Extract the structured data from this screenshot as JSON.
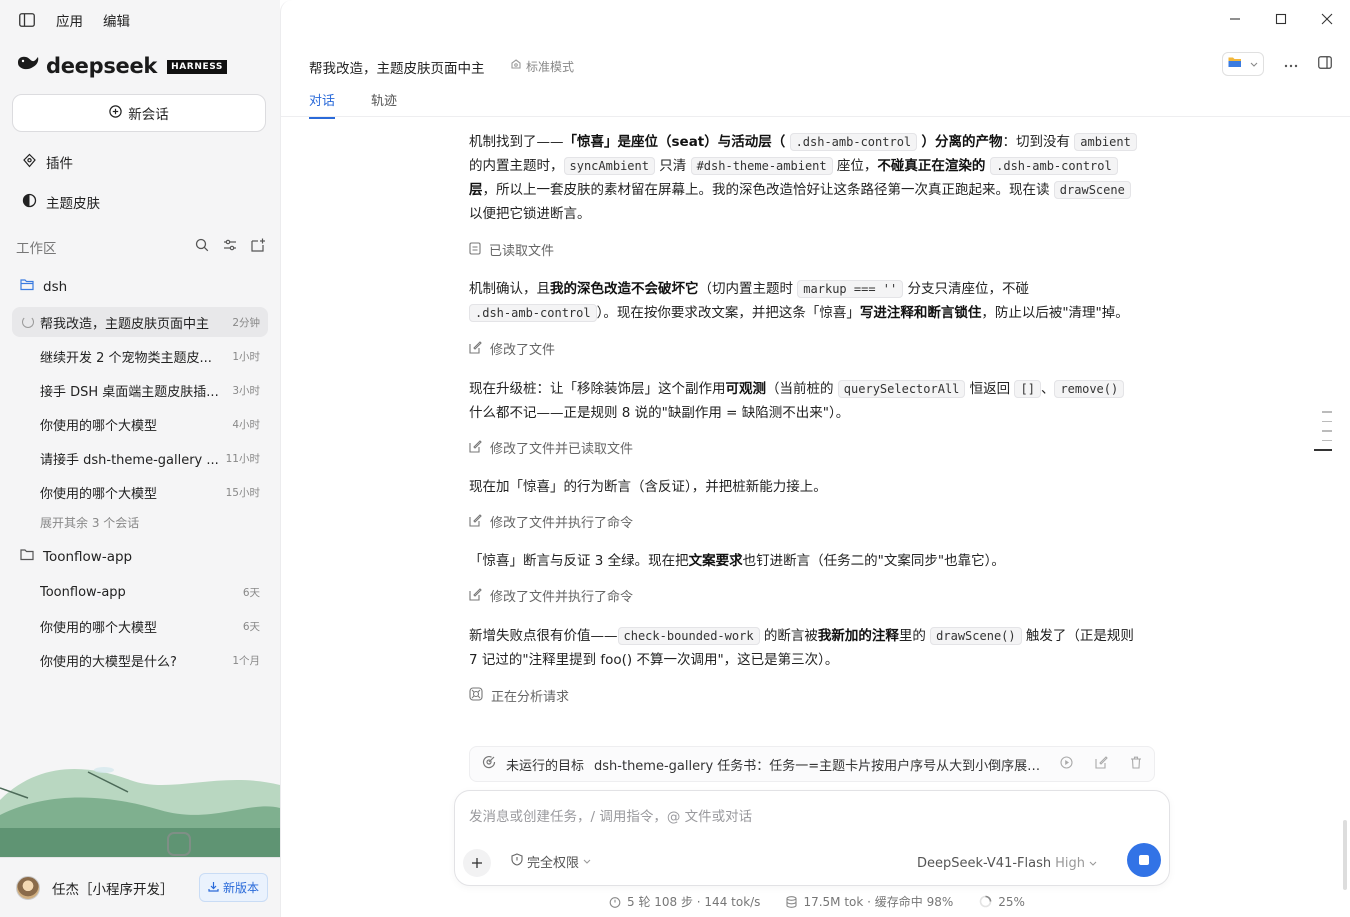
{
  "app": {
    "menu": [
      "应用",
      "编辑"
    ],
    "brand": "deepseek",
    "brand_tag": "HARNESS",
    "accent": "#2a6ad9"
  },
  "sidebar": {
    "new_chat": "新会话",
    "nav": [
      {
        "label": "插件",
        "icon": "plugin-icon"
      },
      {
        "label": "主题皮肤",
        "icon": "theme-icon"
      }
    ],
    "workspace_label": "工作区",
    "projects": [
      {
        "name": "dsh",
        "conversations": [
          {
            "title": "帮我改造，主题皮肤页面中主",
            "time": "2分钟",
            "active": true
          },
          {
            "title": "继续开发 2 个宠物类主题皮...",
            "time": "1小时"
          },
          {
            "title": "接手 DSH 桌面端主题皮肤插...",
            "time": "3小时"
          },
          {
            "title": "你使用的哪个大模型",
            "time": "4小时"
          },
          {
            "title": "请接手 dsh-theme-gallery ...",
            "time": "11小时"
          },
          {
            "title": "你使用的哪个大模型",
            "time": "15小时"
          }
        ],
        "expand": "展开其余 3 个会话"
      },
      {
        "name": "Toonflow-app",
        "conversations": [
          {
            "title": "Toonflow-app",
            "time": "6天"
          },
          {
            "title": "你使用的哪个大模型",
            "time": "6天"
          },
          {
            "title": "你使用的大模型是什么?",
            "time": "1个月"
          }
        ]
      }
    ],
    "user": {
      "name": "任杰［小程序开发］",
      "new_version": "新版本"
    }
  },
  "header": {
    "title": "帮我改造，主题皮肤页面中主",
    "mode": "标准模式",
    "tabs": [
      {
        "label": "对话",
        "active": true
      },
      {
        "label": "轨迹",
        "active": false
      }
    ]
  },
  "messages": {
    "p1": {
      "a": "机制找到了——",
      "b": "「惊喜」是座位（seat）与活动层（",
      "c": ".dsh-amb-control",
      "d": "）分离的产物",
      "e": "：切到没有 ",
      "f": "ambient",
      "g": "的内置主题时，",
      "h": "syncAmbient",
      "i": " 只清 ",
      "j": "#dsh-theme-ambient",
      "k": " 座位，",
      "l": "不碰真正在渲染的 ",
      "m": ".dsh-amb-control",
      "n": "层",
      "o": "，所以上一套皮肤的素材留在屏幕上。我的深色改造恰好让这条路径第一次真正跑起来。现在读 ",
      "p": "drawScene",
      "q": "以便把它锁进断言。"
    },
    "act1": "已读取文件",
    "p2": {
      "a": "机制确认，且",
      "b": "我的深色改造不会破坏它",
      "c": "（切内置主题时 ",
      "d": "markup === ''",
      "e": " 分支只清座位，不碰",
      "f": ".dsh-amb-control",
      "g": "）。现在按你要求改文案，并把这条「惊喜」",
      "h": "写进注释和断言锁住",
      "i": "，防止以后被\"清理\"掉。"
    },
    "act2": "修改了文件",
    "p3": {
      "a": "现在升级桩：让「移除装饰层」这个副作用",
      "b": "可观测",
      "c": "（当前桩的 ",
      "d": "querySelectorAll",
      "e": " 恒返回 ",
      "f": "[]",
      "g": "、",
      "h": "remove()",
      "i": "什么都不记——正是规则 8 说的\"缺副作用 = 缺陷测不出来\"）。"
    },
    "act3": "修改了文件并已读取文件",
    "p4": "现在加「惊喜」的行为断言（含反证），并把桩新能力接上。",
    "act4": "修改了文件并执行了命令",
    "p5": {
      "a": "「惊喜」断言与反证 3 全绿。现在把",
      "b": "文案要求",
      "c": "也钉进断言（任务二的\"文案同步\"也靠它）。"
    },
    "act5": "修改了文件并执行了命令",
    "p6": {
      "a": "新增失败点很有价值——",
      "b": "check-bounded-work",
      "c": " 的断言被",
      "d": "我新加的注释",
      "e": "里的 ",
      "f": "drawScene()",
      "g": " 触发了（正是规则",
      "h": "7 记过的\"注释里提到 foo() 不算一次调用\"，这已是第三次）。"
    },
    "analyzing": "正在分析请求"
  },
  "task": {
    "label": "未运行的目标",
    "text": "dsh-theme-gallery 任务书：任务一=主题卡片按用户序号从大到小倒序展示..."
  },
  "composer": {
    "placeholder": "发消息或创建任务，/ 调用指令，@ 文件或对话",
    "permission": "完全权限",
    "model": "DeepSeek-V41-Flash",
    "level": "High"
  },
  "stats": {
    "steps": "5 轮 108 步 · 144 tok/s",
    "tokens": "17.5M tok · 缓存命中 98%",
    "context": "25%"
  }
}
